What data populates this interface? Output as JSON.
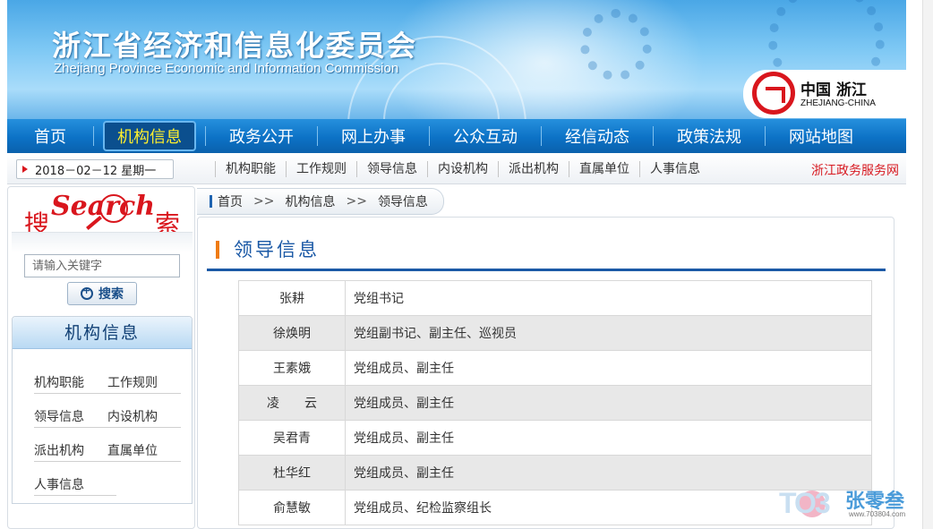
{
  "header": {
    "title_cn": "浙江省经济和信息化委员会",
    "title_en": "Zhejiang Province Economic and Information Commission",
    "logo_cn": "中国 浙江",
    "logo_en": "ZHEJIANG-CHINA"
  },
  "main_nav": [
    {
      "label": "首页",
      "active": false
    },
    {
      "label": "机构信息",
      "active": true
    },
    {
      "label": "政务公开",
      "active": false
    },
    {
      "label": "网上办事",
      "active": false
    },
    {
      "label": "公众互动",
      "active": false
    },
    {
      "label": "经信动态",
      "active": false
    },
    {
      "label": "政策法规",
      "active": false
    },
    {
      "label": "网站地图",
      "active": false
    }
  ],
  "sub_bar": {
    "date": "2018－02－12  星期一",
    "links": [
      "机构职能",
      "工作规则",
      "领导信息",
      "内设机构",
      "派出机构",
      "直属单位",
      "人事信息"
    ],
    "service_link": "浙江政务服务网"
  },
  "sidebar": {
    "search_logo": {
      "left_char": "搜",
      "word": "Search",
      "right_char": "索"
    },
    "search_placeholder": "请输入关键字",
    "search_button": "搜索",
    "org_title": "机构信息",
    "org_links": [
      [
        "机构职能",
        "工作规则"
      ],
      [
        "领导信息",
        "内设机构"
      ],
      [
        "派出机构",
        "直属单位"
      ],
      [
        "人事信息",
        ""
      ]
    ]
  },
  "breadcrumb": [
    "首页",
    "机构信息",
    "领导信息"
  ],
  "breadcrumb_sep": ">>",
  "content": {
    "title": "领导信息",
    "leaders": [
      {
        "name": "张耕",
        "position": "党组书记"
      },
      {
        "name": "徐焕明",
        "position": "党组副书记、副主任、巡视员"
      },
      {
        "name": "王素娥",
        "position": "党组成员、副主任"
      },
      {
        "name": "凌　　云",
        "position": "党组成员、副主任"
      },
      {
        "name": "吴君青",
        "position": "党组成员、副主任"
      },
      {
        "name": "杜华红",
        "position": "党组成员、副主任"
      },
      {
        "name": "俞慧敏",
        "position": "党组成员、纪检监察组长"
      }
    ]
  },
  "watermark": {
    "text": "TO3",
    "cn": "张零叁",
    "url": "www.703804.com"
  },
  "colors": {
    "nav_blue": "#0c72c6",
    "accent_red": "#d9161d",
    "active_yellow": "#ffef2d",
    "title_blue": "#1b59a6",
    "orange_mark": "#ef7b12"
  }
}
